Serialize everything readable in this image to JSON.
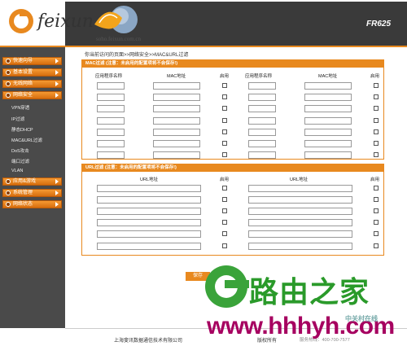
{
  "header": {
    "brand": "feixun",
    "site": "soho.feixun.com.cn",
    "model": "FR625"
  },
  "sidebar": {
    "items": [
      {
        "label": "快速向导"
      },
      {
        "label": "基本设置"
      },
      {
        "label": "无线网络"
      },
      {
        "label": "网络安全"
      }
    ],
    "sub_items": [
      "VPN穿透",
      "IP过滤",
      "静态DHCP",
      "MAC&URL过滤",
      "DoS攻击",
      "端口过滤",
      "VLAN"
    ],
    "items2": [
      {
        "label": "应用&游戏"
      },
      {
        "label": "系统管理"
      },
      {
        "label": "网络状态"
      }
    ]
  },
  "breadcrumb": "你当前访问的页面>>网络安全>>MAC&URL过滤",
  "mac_panel": {
    "title": "MAC过滤 (注意：未启用的配置项将不会保存!)",
    "headers": [
      "应用程序名称",
      "MAC地址",
      "启用",
      "应用程序名称",
      "MAC地址",
      "启用"
    ]
  },
  "url_panel": {
    "title": "URL过滤 (注意：未启用的配置项将不会保存!)",
    "headers": [
      "URL地址",
      "启用",
      "URL地址",
      "启用"
    ]
  },
  "buttons": {
    "save": "保存"
  },
  "footer": {
    "company": "上海斐讯数据通信技术有限公司",
    "copyright": "版权所有",
    "hotline": "服务热线：400-700-7577"
  },
  "watermark": {
    "cn": "路由之家",
    "url": "www.hhhyh.com",
    "small": "中关村在线"
  },
  "colors": {
    "accent": "#e8891f",
    "sidebar": "#4a4a4a",
    "header": "#3a3a3a"
  }
}
